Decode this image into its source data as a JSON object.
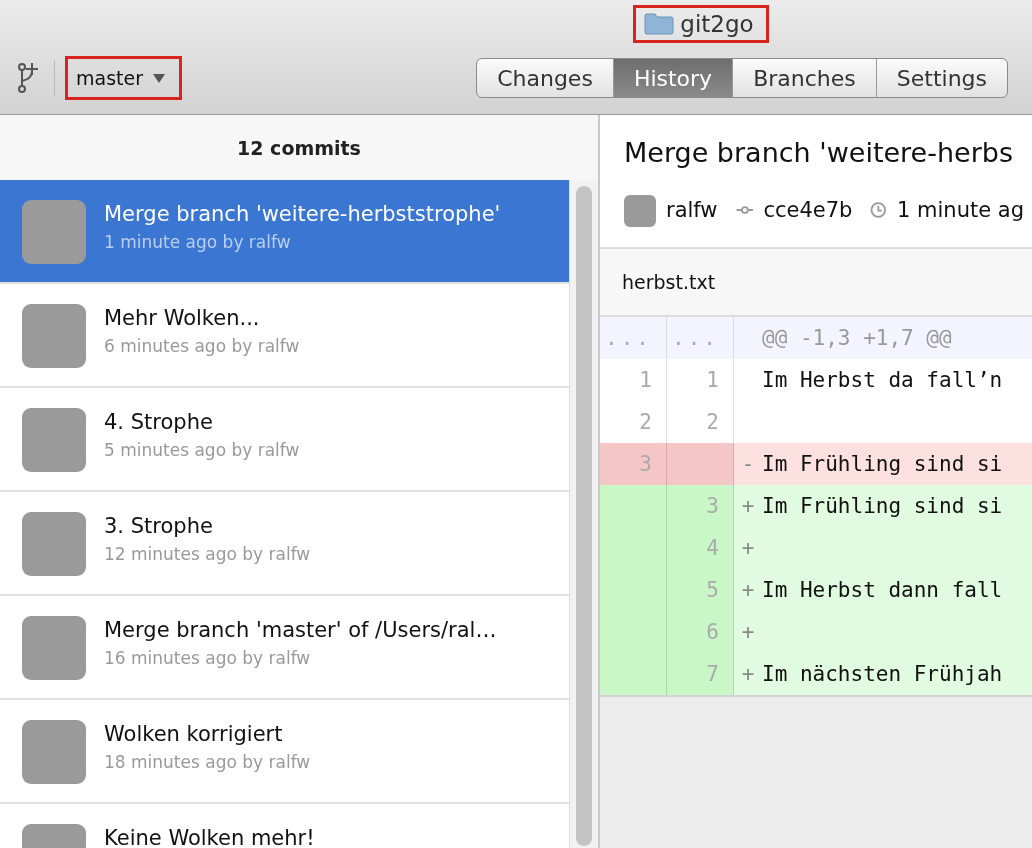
{
  "window": {
    "title": "git2go",
    "title_highlighted": true
  },
  "toolbar": {
    "branch": "master",
    "branch_highlighted": true
  },
  "tabs": [
    {
      "label": "Changes",
      "selected": false
    },
    {
      "label": "History",
      "selected": true
    },
    {
      "label": "Branches",
      "selected": false
    },
    {
      "label": "Settings",
      "selected": false
    }
  ],
  "history": {
    "count": "12 commits",
    "commits": [
      {
        "message": "Merge branch 'weitere-herbststrophe'",
        "meta": "1 minute ago by ralfw",
        "selected": true
      },
      {
        "message": "Mehr Wolken...",
        "meta": "6 minutes ago by ralfw",
        "selected": false
      },
      {
        "message": "4. Strophe",
        "meta": "5 minutes ago by ralfw",
        "selected": false
      },
      {
        "message": "3. Strophe",
        "meta": "12 minutes ago by ralfw",
        "selected": false
      },
      {
        "message": "Merge branch 'master' of /Users/ral…",
        "meta": "16 minutes ago by ralfw",
        "selected": false
      },
      {
        "message": "Wolken korrigiert",
        "meta": "18 minutes ago by ralfw",
        "selected": false
      },
      {
        "message": "Keine Wolken mehr!",
        "selected": false
      }
    ]
  },
  "commit": {
    "title": "Merge branch 'weitere-herbs",
    "author": "ralfw",
    "sha": "cce4e7b",
    "time": "1 minute ag",
    "file": "herbst.txt",
    "lines": [
      {
        "kind": "hunk",
        "old": "...",
        "new": "...",
        "text": "@@ -1,3 +1,7 @@"
      },
      {
        "kind": "context",
        "old": "1",
        "new": "1",
        "text": "Im Herbst da fall’n"
      },
      {
        "kind": "context",
        "old": "2",
        "new": "2"
      },
      {
        "kind": "del",
        "old": "3",
        "sign": "-",
        "text": "Im Frühling sind si"
      },
      {
        "kind": "add",
        "new": "3",
        "sign": "+",
        "text": "Im Frühling sind si"
      },
      {
        "kind": "add",
        "new": "4",
        "sign": "+"
      },
      {
        "kind": "add",
        "new": "5",
        "sign": "+",
        "text": "Im Herbst dann fall"
      },
      {
        "kind": "add",
        "new": "6",
        "sign": "+"
      },
      {
        "kind": "add",
        "new": "7",
        "sign": "+",
        "text": "Im nächsten Frühjah"
      }
    ]
  }
}
